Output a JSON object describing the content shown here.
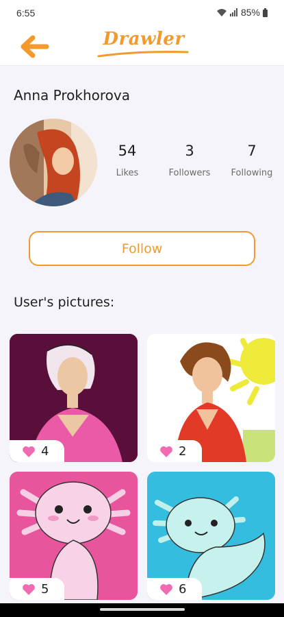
{
  "status_bar": {
    "time": "6:55",
    "battery": "85%"
  },
  "app": {
    "brand": "Drawler"
  },
  "profile": {
    "name": "Anna Prokhorova",
    "stats": [
      {
        "value": "54",
        "label": "Likes"
      },
      {
        "value": "3",
        "label": "Followers"
      },
      {
        "value": "7",
        "label": "Following"
      }
    ],
    "follow_label": "Follow"
  },
  "pictures": {
    "title": "User's pictures:",
    "items": [
      {
        "likes": "4",
        "background": "#5a0f3a"
      },
      {
        "likes": "2",
        "background": "#ffffff"
      },
      {
        "likes": "5",
        "background": "#e8559c"
      },
      {
        "likes": "6",
        "background": "#35bde0"
      }
    ]
  },
  "colors": {
    "accent": "#f39a2d",
    "heart": "#f06bb2",
    "background": "#f4f4fa"
  }
}
